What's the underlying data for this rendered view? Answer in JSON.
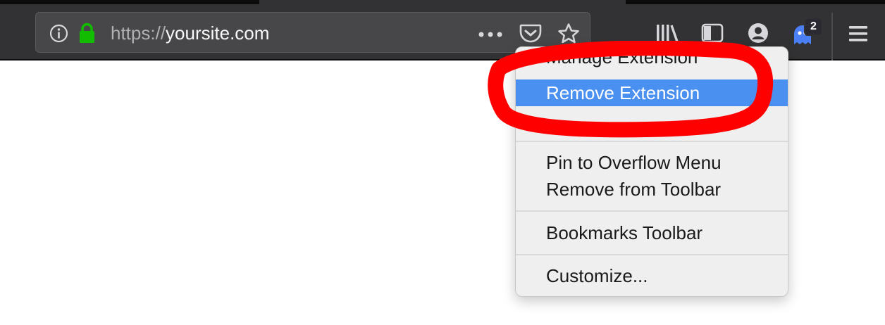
{
  "toolbar": {
    "url_scheme": "https://",
    "url_host": "yoursite.com",
    "extension_badge_count": "2"
  },
  "context_menu": {
    "partial_item_label": "Manage Extension",
    "items": [
      {
        "label": "Remove Extension",
        "highlighted": true
      },
      {
        "label": "Pin to Overflow Menu"
      },
      {
        "label": "Remove from Toolbar"
      },
      {
        "label": "Bookmarks Toolbar"
      },
      {
        "label": "Customize..."
      }
    ]
  },
  "colors": {
    "toolbar_bg": "#323234",
    "urlbar_bg": "#474749",
    "lock_green": "#12bc00",
    "highlight_blue": "#4a90f0",
    "annotation_red": "#ff0000",
    "badge_bg": "#2b2a33",
    "extension_blue": "#4a7ff5"
  },
  "icons": {
    "info": "info-icon",
    "lock": "lock-icon",
    "more": "more-icon",
    "pocket": "pocket-icon",
    "star": "star-icon",
    "library": "library-icon",
    "sidebar": "sidebar-icon",
    "account": "account-icon",
    "extension": "ghost-extension-icon",
    "menu": "hamburger-menu-icon"
  }
}
